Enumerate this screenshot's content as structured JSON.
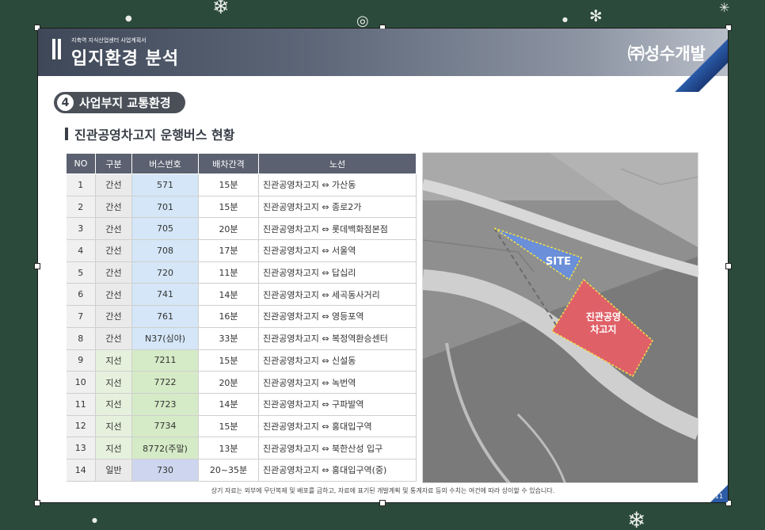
{
  "header": {
    "subtitle": "지축역 지식산업센터 사업계획서",
    "title": "입지환경 분석",
    "brand": "㈜성수개발"
  },
  "section": {
    "number": "4",
    "title": "사업부지 교통환경"
  },
  "subtitle": "진관공영차고지 운행버스 현황",
  "table": {
    "headers": [
      "NO",
      "구분",
      "버스번호",
      "배차간격",
      "노선"
    ],
    "rows": [
      {
        "no": "1",
        "type": "간선",
        "bus": "571",
        "interval": "15분",
        "route": "진관공영차고지 ⇔ 가산동",
        "kind": "trunk"
      },
      {
        "no": "2",
        "type": "간선",
        "bus": "701",
        "interval": "15분",
        "route": "진관공영차고지 ⇔ 종로2가",
        "kind": "trunk"
      },
      {
        "no": "3",
        "type": "간선",
        "bus": "705",
        "interval": "20분",
        "route": "진관공영차고지 ⇔ 롯데백화점본점",
        "kind": "trunk"
      },
      {
        "no": "4",
        "type": "간선",
        "bus": "708",
        "interval": "17분",
        "route": "진관공영차고지 ⇔ 서울역",
        "kind": "trunk"
      },
      {
        "no": "5",
        "type": "간선",
        "bus": "720",
        "interval": "11분",
        "route": "진관공영차고지 ⇔ 답십리",
        "kind": "trunk"
      },
      {
        "no": "6",
        "type": "간선",
        "bus": "741",
        "interval": "14분",
        "route": "진관공영차고지 ⇔ 세곡동사거리",
        "kind": "trunk"
      },
      {
        "no": "7",
        "type": "간선",
        "bus": "761",
        "interval": "16분",
        "route": "진관공영차고지 ⇔ 영등포역",
        "kind": "trunk"
      },
      {
        "no": "8",
        "type": "간선",
        "bus": "N37(심야)",
        "interval": "33분",
        "route": "진관공영차고지 ⇔ 복정역환승센터",
        "kind": "trunk"
      },
      {
        "no": "9",
        "type": "지선",
        "bus": "7211",
        "interval": "15분",
        "route": "진관공영차고지 ⇔ 신설동",
        "kind": "branch"
      },
      {
        "no": "10",
        "type": "지선",
        "bus": "7722",
        "interval": "20분",
        "route": "진관공영차고지 ⇔ 녹번역",
        "kind": "branch"
      },
      {
        "no": "11",
        "type": "지선",
        "bus": "7723",
        "interval": "14분",
        "route": "진관공영차고지 ⇔ 구파발역",
        "kind": "branch"
      },
      {
        "no": "12",
        "type": "지선",
        "bus": "7734",
        "interval": "15분",
        "route": "진관공영차고지 ⇔ 홍대입구역",
        "kind": "branch"
      },
      {
        "no": "13",
        "type": "지선",
        "bus": "8772(주말)",
        "interval": "13분",
        "route": "진관공영차고지 ⇔ 북한산성 입구",
        "kind": "branch"
      },
      {
        "no": "14",
        "type": "일반",
        "bus": "730",
        "interval": "20~35분",
        "route": "진관공영차고지 ⇔ 홍대입구역(중)",
        "kind": "general"
      }
    ]
  },
  "map": {
    "site_label": "SITE",
    "depot_label_line1": "진관공영",
    "depot_label_line2": "차고지",
    "site_color": "#6b8fd8",
    "depot_color": "#e06068"
  },
  "footnote": "상기 자료는 외부에 무단복제 및 배포를 금하고, 자료에 표기된 개발계획 및 통계자료 등의 수치는 여건에 따라 상이할 수 있습니다.",
  "page_number": "11",
  "colors": {
    "background": "#2b4a3b",
    "header_dark": "#3e4858",
    "accent_blue": "#2d5ca6"
  }
}
